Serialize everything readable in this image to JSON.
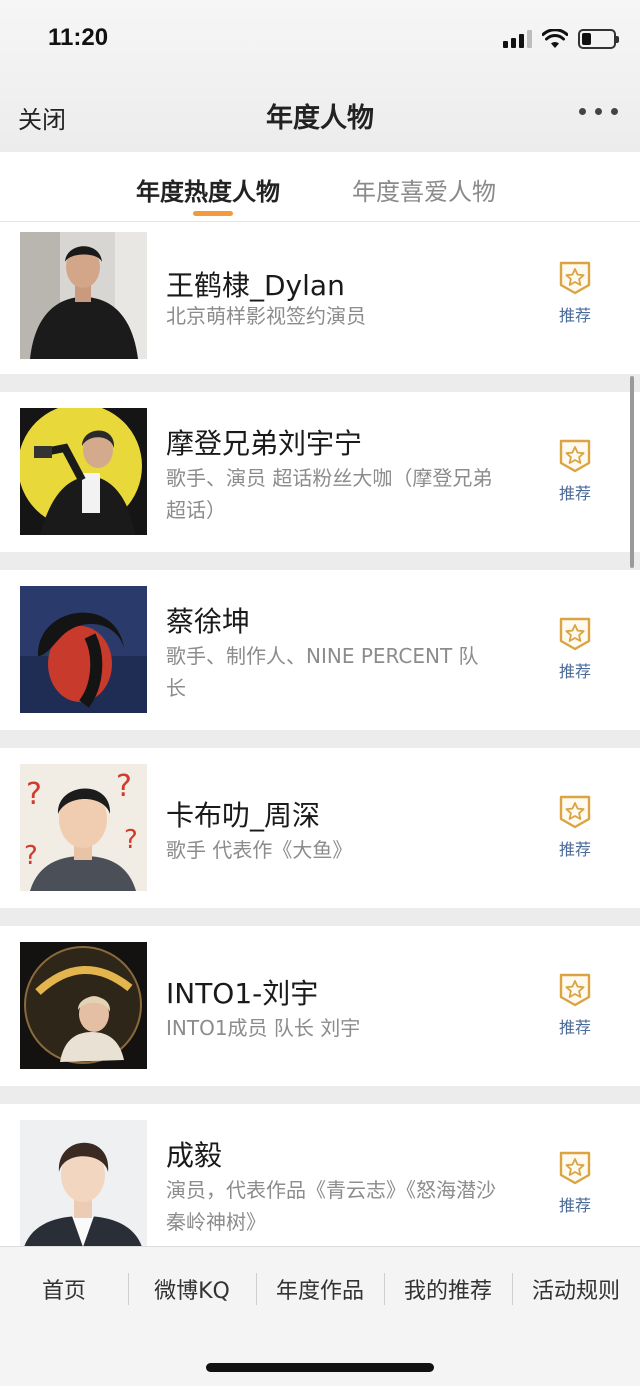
{
  "status_bar": {
    "time": "11:20"
  },
  "nav": {
    "close_label": "关闭",
    "title": "年度人物"
  },
  "tabs": [
    {
      "label": "年度热度人物",
      "active": true
    },
    {
      "label": "年度喜爱人物",
      "active": false
    }
  ],
  "recommend_label": "推荐",
  "people": [
    {
      "name": "王鹤棣_Dylan",
      "description": "北京萌样影视签约演员"
    },
    {
      "name": "摩登兄弟刘宇宁",
      "description": "歌手、演员 超话粉丝大咖（摩登兄弟超话）"
    },
    {
      "name": "蔡徐坤",
      "description": "歌手、制作人、NINE PERCENT 队长"
    },
    {
      "name": "卡布叻_周深",
      "description": "歌手 代表作《大鱼》"
    },
    {
      "name": "INTO1-刘宇",
      "description": "INTO1成员 队长 刘宇"
    },
    {
      "name": "成毅",
      "description": "演员，代表作品《青云志》《怒海潜沙 秦岭神树》"
    }
  ],
  "bottom_tabs": [
    "首页",
    "微博KQ",
    "年度作品",
    "我的推荐",
    "活动规则"
  ],
  "colors": {
    "accent_orange": "#f39a3c",
    "recommend_gold": "#d9a441",
    "recommend_text": "#4a6a98"
  }
}
